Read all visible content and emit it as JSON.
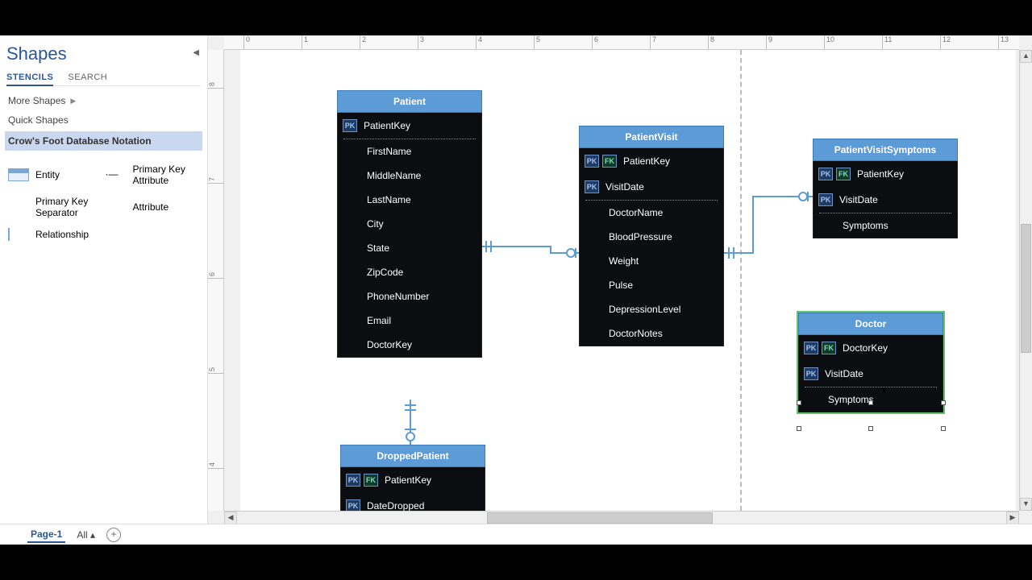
{
  "shapes_panel": {
    "title": "Shapes",
    "tabs": [
      "STENCILS",
      "SEARCH"
    ],
    "more": "More Shapes",
    "quick": "Quick Shapes",
    "section": "Crow's Foot Database Notation",
    "items": {
      "entity": "Entity",
      "pka": "Primary Key Attribute",
      "pks": "Primary Key Separator",
      "attr": "Attribute",
      "rel": "Relationship"
    }
  },
  "ruler_h": [
    "0",
    "1",
    "2",
    "3",
    "4",
    "5",
    "6",
    "7",
    "8",
    "9",
    "10",
    "11",
    "12",
    "13"
  ],
  "ruler_v": [
    "8",
    "7",
    "6",
    "5",
    "4"
  ],
  "entities": {
    "patient": {
      "title": "Patient",
      "rows": [
        {
          "pk": true,
          "name": "PatientKey"
        },
        {
          "name": "FirstName"
        },
        {
          "name": "MiddleName"
        },
        {
          "name": "LastName"
        },
        {
          "name": "City"
        },
        {
          "name": "State"
        },
        {
          "name": "ZipCode"
        },
        {
          "name": "PhoneNumber"
        },
        {
          "name": "Email"
        },
        {
          "name": "DoctorKey"
        }
      ]
    },
    "patientvisit": {
      "title": "PatientVisit",
      "rows": [
        {
          "pk": true,
          "fk": true,
          "name": "PatientKey"
        },
        {
          "pk": true,
          "name": "VisitDate"
        },
        {
          "name": "DoctorName"
        },
        {
          "name": "BloodPressure"
        },
        {
          "name": "Weight"
        },
        {
          "name": "Pulse"
        },
        {
          "name": "DepressionLevel"
        },
        {
          "name": "DoctorNotes"
        }
      ]
    },
    "pvs": {
      "title": "PatientVisitSymptoms",
      "rows": [
        {
          "pk": true,
          "fk": true,
          "name": "PatientKey"
        },
        {
          "pk": true,
          "name": "VisitDate"
        },
        {
          "name": "Symptoms"
        }
      ]
    },
    "doctor": {
      "title": "Doctor",
      "rows": [
        {
          "pk": true,
          "fk": true,
          "name": "DoctorKey"
        },
        {
          "pk": true,
          "name": "VisitDate"
        },
        {
          "name": "Symptoms"
        }
      ]
    },
    "dropped": {
      "title": "DroppedPatient",
      "rows": [
        {
          "pk": true,
          "fk": true,
          "name": "PatientKey"
        },
        {
          "pk": true,
          "name": "DateDropped"
        }
      ]
    }
  },
  "footer": {
    "page": "Page-1",
    "all": "All"
  }
}
